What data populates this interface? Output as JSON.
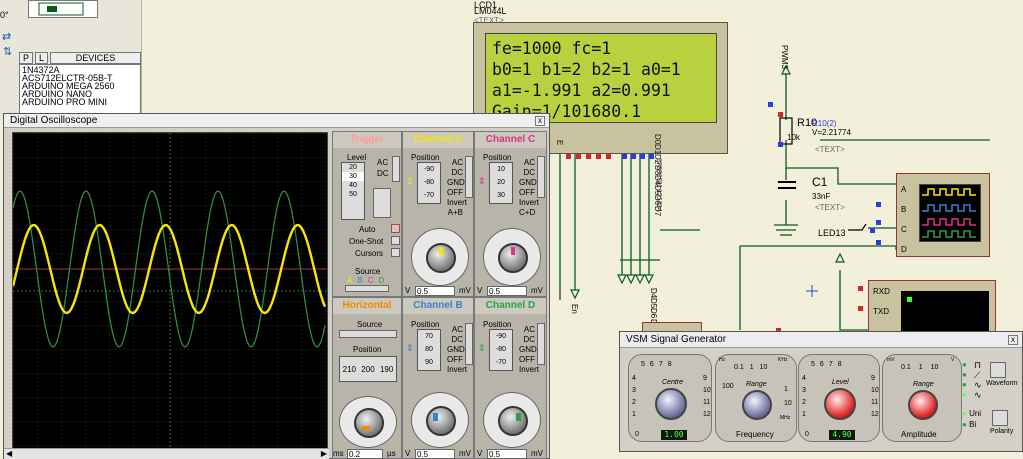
{
  "schematic": {
    "lcd_ref": "LCD1",
    "lcd_part": "LM044L",
    "text_tag": "<TEXT>",
    "lcd_lines": [
      "fe=1000 fc=1",
      "b0=1 b1=2 b2=1 a0=1",
      "a1=-1.991 a2=0.991",
      "Gain=1/101680.1"
    ],
    "pins_top": [
      "E",
      "D0",
      "D1",
      "D2",
      "D3",
      "D4",
      "D5",
      "D6",
      "D7"
    ],
    "pin_numbers": [
      "6",
      "7",
      "8",
      "9",
      "10",
      "11",
      "12",
      "13",
      "14"
    ],
    "pins_bottom": [
      "D4",
      "D5",
      "D6",
      "D7"
    ],
    "en_label": "En",
    "pwm_label": "PWM3",
    "r_ref": "R10",
    "r_value": "10k",
    "r_probe": "R10(2)",
    "r_probe_voltage": "V=2.21774",
    "c_ref": "C1",
    "c_value": "33nF",
    "led_label": "LED13",
    "scope_pins": [
      "A",
      "B",
      "C",
      "D"
    ],
    "term_pins": [
      "RXD",
      "TXD"
    ]
  },
  "left_panel": {
    "tabs": [
      "P",
      "L",
      "DEVICES"
    ],
    "devices": [
      "1N4372A",
      "ACS712ELCTR-05B-T",
      "ARDUINO MEGA 2560",
      "ARDUINO NANO",
      "ARDUINO PRO MINI"
    ],
    "zoom": "0°"
  },
  "oscilloscope": {
    "title": "Digital Oscilloscope",
    "close": "x",
    "trigger": {
      "title": "Trigger",
      "level_label": "Level",
      "scale": [
        "20",
        "30",
        "40",
        "50"
      ],
      "ac": "AC",
      "dc": "DC",
      "auto": "Auto",
      "one_shot": "One-Shot",
      "cursors": "Cursors",
      "source": "Source",
      "source_letters": [
        "A",
        "B",
        "C",
        "D"
      ]
    },
    "channel_a": {
      "title": "Channel A",
      "position": "Position",
      "scale": [
        "-90",
        "-80",
        "-70"
      ],
      "opts": [
        "AC",
        "DC",
        "GND",
        "OFF",
        "Invert"
      ],
      "combo": "A+B",
      "value": "0.5",
      "dial_left": "V",
      "dial_right": "mV"
    },
    "channel_c": {
      "title": "Channel C",
      "position": "Position",
      "scale": [
        "10",
        "20",
        "30"
      ],
      "opts": [
        "AC",
        "DC",
        "GND",
        "OFF",
        "Invert"
      ],
      "combo": "C+D",
      "value": "0.5",
      "dial_left": "V",
      "dial_right": "mV"
    },
    "horizontal": {
      "title": "Horizontal",
      "source": "Source",
      "position": "Position",
      "readout": [
        "210",
        "200",
        "190"
      ],
      "value": "0.2",
      "dial_left": "ms",
      "dial_right": "µs"
    },
    "channel_b": {
      "title": "Channel B",
      "position": "Position",
      "scale": [
        "70",
        "80",
        "90"
      ],
      "opts": [
        "AC",
        "DC",
        "GND",
        "OFF",
        "Invert"
      ],
      "value": "0.5",
      "dial_left": "V",
      "dial_right": "mV"
    },
    "channel_d": {
      "title": "Channel D",
      "position": "Position",
      "scale": [
        "-90",
        "-80",
        "-70"
      ],
      "opts": [
        "AC",
        "DC",
        "GND",
        "OFF",
        "Invert"
      ],
      "value": "0.5",
      "dial_left": "V",
      "dial_right": "mV"
    },
    "colors": {
      "channel_a": "#f7e600",
      "channel_b": "#3a7fd0",
      "channel_c": "#e0308c",
      "channel_d": "#2aa04a",
      "trigger": "#ff9b9b",
      "horizontal": "#f08a00"
    }
  },
  "signal_generator": {
    "title": "VSM Signal Generator",
    "close": "x",
    "centre": {
      "label": "Centre",
      "value": "1.00",
      "scale": [
        "0",
        "1",
        "2",
        "3",
        "4",
        "5",
        "6",
        "7",
        "8",
        "9",
        "10",
        "11",
        "12"
      ]
    },
    "range_freq": {
      "label": "Range",
      "scale": [
        "0.1",
        "1",
        "10",
        "100",
        "1",
        "10"
      ],
      "units": [
        "Hz",
        "KHz",
        "MHz"
      ],
      "caption": "Frequency"
    },
    "level": {
      "label": "Level",
      "value": "4.90",
      "scale": [
        "0",
        "1",
        "2",
        "3",
        "4",
        "5",
        "6",
        "7",
        "8",
        "9",
        "10",
        "11",
        "12"
      ]
    },
    "range_amp": {
      "label": "Range",
      "scale": [
        "0.1",
        "1",
        "10"
      ],
      "units": [
        "mV",
        "V"
      ],
      "caption": "Amplitude"
    },
    "waveform": "Waveform",
    "uni": "Uni",
    "bi": "Bi",
    "polarity": "Polarity"
  }
}
